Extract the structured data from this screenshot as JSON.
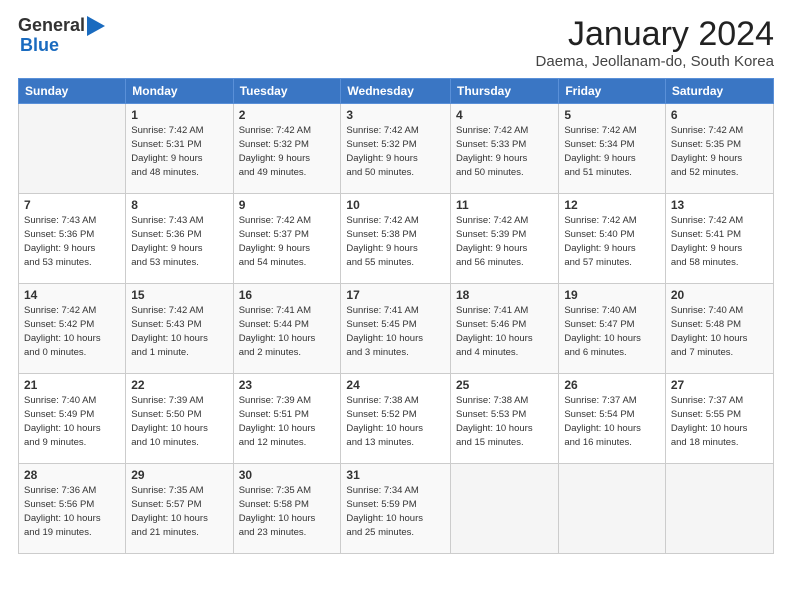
{
  "header": {
    "logo_general": "General",
    "logo_blue": "Blue",
    "month": "January 2024",
    "location": "Daema, Jeollanam-do, South Korea"
  },
  "weekdays": [
    "Sunday",
    "Monday",
    "Tuesday",
    "Wednesday",
    "Thursday",
    "Friday",
    "Saturday"
  ],
  "weeks": [
    [
      {
        "day": "",
        "info": ""
      },
      {
        "day": "1",
        "info": "Sunrise: 7:42 AM\nSunset: 5:31 PM\nDaylight: 9 hours\nand 48 minutes."
      },
      {
        "day": "2",
        "info": "Sunrise: 7:42 AM\nSunset: 5:32 PM\nDaylight: 9 hours\nand 49 minutes."
      },
      {
        "day": "3",
        "info": "Sunrise: 7:42 AM\nSunset: 5:32 PM\nDaylight: 9 hours\nand 50 minutes."
      },
      {
        "day": "4",
        "info": "Sunrise: 7:42 AM\nSunset: 5:33 PM\nDaylight: 9 hours\nand 50 minutes."
      },
      {
        "day": "5",
        "info": "Sunrise: 7:42 AM\nSunset: 5:34 PM\nDaylight: 9 hours\nand 51 minutes."
      },
      {
        "day": "6",
        "info": "Sunrise: 7:42 AM\nSunset: 5:35 PM\nDaylight: 9 hours\nand 52 minutes."
      }
    ],
    [
      {
        "day": "7",
        "info": "Sunrise: 7:43 AM\nSunset: 5:36 PM\nDaylight: 9 hours\nand 53 minutes."
      },
      {
        "day": "8",
        "info": "Sunrise: 7:43 AM\nSunset: 5:36 PM\nDaylight: 9 hours\nand 53 minutes."
      },
      {
        "day": "9",
        "info": "Sunrise: 7:42 AM\nSunset: 5:37 PM\nDaylight: 9 hours\nand 54 minutes."
      },
      {
        "day": "10",
        "info": "Sunrise: 7:42 AM\nSunset: 5:38 PM\nDaylight: 9 hours\nand 55 minutes."
      },
      {
        "day": "11",
        "info": "Sunrise: 7:42 AM\nSunset: 5:39 PM\nDaylight: 9 hours\nand 56 minutes."
      },
      {
        "day": "12",
        "info": "Sunrise: 7:42 AM\nSunset: 5:40 PM\nDaylight: 9 hours\nand 57 minutes."
      },
      {
        "day": "13",
        "info": "Sunrise: 7:42 AM\nSunset: 5:41 PM\nDaylight: 9 hours\nand 58 minutes."
      }
    ],
    [
      {
        "day": "14",
        "info": "Sunrise: 7:42 AM\nSunset: 5:42 PM\nDaylight: 10 hours\nand 0 minutes."
      },
      {
        "day": "15",
        "info": "Sunrise: 7:42 AM\nSunset: 5:43 PM\nDaylight: 10 hours\nand 1 minute."
      },
      {
        "day": "16",
        "info": "Sunrise: 7:41 AM\nSunset: 5:44 PM\nDaylight: 10 hours\nand 2 minutes."
      },
      {
        "day": "17",
        "info": "Sunrise: 7:41 AM\nSunset: 5:45 PM\nDaylight: 10 hours\nand 3 minutes."
      },
      {
        "day": "18",
        "info": "Sunrise: 7:41 AM\nSunset: 5:46 PM\nDaylight: 10 hours\nand 4 minutes."
      },
      {
        "day": "19",
        "info": "Sunrise: 7:40 AM\nSunset: 5:47 PM\nDaylight: 10 hours\nand 6 minutes."
      },
      {
        "day": "20",
        "info": "Sunrise: 7:40 AM\nSunset: 5:48 PM\nDaylight: 10 hours\nand 7 minutes."
      }
    ],
    [
      {
        "day": "21",
        "info": "Sunrise: 7:40 AM\nSunset: 5:49 PM\nDaylight: 10 hours\nand 9 minutes."
      },
      {
        "day": "22",
        "info": "Sunrise: 7:39 AM\nSunset: 5:50 PM\nDaylight: 10 hours\nand 10 minutes."
      },
      {
        "day": "23",
        "info": "Sunrise: 7:39 AM\nSunset: 5:51 PM\nDaylight: 10 hours\nand 12 minutes."
      },
      {
        "day": "24",
        "info": "Sunrise: 7:38 AM\nSunset: 5:52 PM\nDaylight: 10 hours\nand 13 minutes."
      },
      {
        "day": "25",
        "info": "Sunrise: 7:38 AM\nSunset: 5:53 PM\nDaylight: 10 hours\nand 15 minutes."
      },
      {
        "day": "26",
        "info": "Sunrise: 7:37 AM\nSunset: 5:54 PM\nDaylight: 10 hours\nand 16 minutes."
      },
      {
        "day": "27",
        "info": "Sunrise: 7:37 AM\nSunset: 5:55 PM\nDaylight: 10 hours\nand 18 minutes."
      }
    ],
    [
      {
        "day": "28",
        "info": "Sunrise: 7:36 AM\nSunset: 5:56 PM\nDaylight: 10 hours\nand 19 minutes."
      },
      {
        "day": "29",
        "info": "Sunrise: 7:35 AM\nSunset: 5:57 PM\nDaylight: 10 hours\nand 21 minutes."
      },
      {
        "day": "30",
        "info": "Sunrise: 7:35 AM\nSunset: 5:58 PM\nDaylight: 10 hours\nand 23 minutes."
      },
      {
        "day": "31",
        "info": "Sunrise: 7:34 AM\nSunset: 5:59 PM\nDaylight: 10 hours\nand 25 minutes."
      },
      {
        "day": "",
        "info": ""
      },
      {
        "day": "",
        "info": ""
      },
      {
        "day": "",
        "info": ""
      }
    ]
  ]
}
